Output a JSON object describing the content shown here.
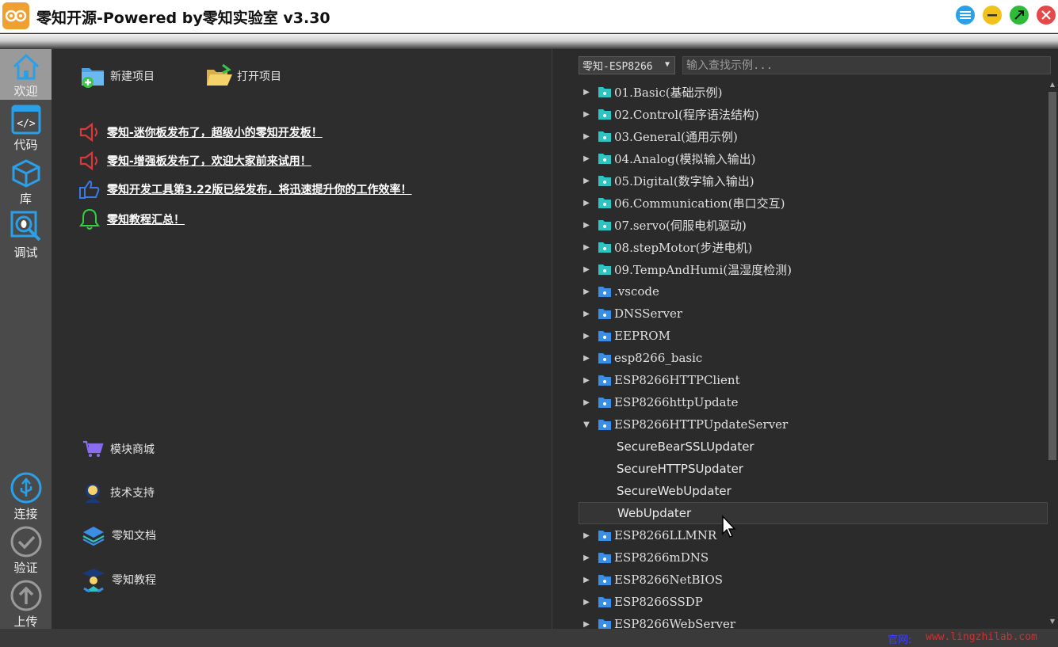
{
  "window": {
    "title": "零知开源-Powered by零知实验室 v3.30"
  },
  "colors": {
    "accent_blue": "#2aa0e8",
    "nav_bg": "#4a4a4a",
    "panel_bg": "#2d2d2d",
    "folder_teal": "#2ec4c4",
    "folder_blue": "#3a8ee6",
    "news_red": "#d83a3a",
    "news_blue": "#3a7ae6",
    "news_green": "#30d040",
    "site_label": "#4040ff",
    "site_url": "#d03030"
  },
  "nav": {
    "welcome": "欢迎",
    "code": "代码",
    "library": "库",
    "debug": "调试",
    "connect": "连接",
    "verify": "验证",
    "upload": "上传"
  },
  "toolbar": {
    "new_project": "新建项目",
    "open_project": "打开项目"
  },
  "news": [
    {
      "text": "零知-迷你板发布了，超级小的零知开发板！",
      "icon": "speaker-icon"
    },
    {
      "text": "零知-增强板发布了，欢迎大家前来试用！",
      "icon": "speaker-icon"
    },
    {
      "text": "零知开发工具第3.22版已经发布，将迅速提升你的工作效率！",
      "icon": "thumbs-up-icon"
    },
    {
      "text": "零知教程汇总！",
      "icon": "bell-icon"
    }
  ],
  "links": {
    "shop": "模块商城",
    "support": "技术支持",
    "docs": "零知文档",
    "tutorial": "零知教程"
  },
  "examples": {
    "board": "零知-ESP8266",
    "search_placeholder": "输入查找示例...",
    "tree": [
      {
        "name": "01.Basic(基础示例)",
        "type": "teal",
        "expanded": false
      },
      {
        "name": "02.Control(程序语法结构)",
        "type": "teal",
        "expanded": false
      },
      {
        "name": "03.General(通用示例)",
        "type": "teal",
        "expanded": false
      },
      {
        "name": "04.Analog(模拟输入输出)",
        "type": "teal",
        "expanded": false
      },
      {
        "name": "05.Digital(数字输入输出)",
        "type": "teal",
        "expanded": false
      },
      {
        "name": "06.Communication(串口交互)",
        "type": "teal",
        "expanded": false
      },
      {
        "name": "07.servo(伺服电机驱动)",
        "type": "teal",
        "expanded": false
      },
      {
        "name": "08.stepMotor(步进电机)",
        "type": "teal",
        "expanded": false
      },
      {
        "name": "09.TempAndHumi(温湿度检测)",
        "type": "teal",
        "expanded": false
      },
      {
        "name": ".vscode",
        "type": "blue",
        "expanded": false
      },
      {
        "name": "DNSServer",
        "type": "blue",
        "expanded": false
      },
      {
        "name": "EEPROM",
        "type": "blue",
        "expanded": false
      },
      {
        "name": "esp8266_basic",
        "type": "blue",
        "expanded": false
      },
      {
        "name": "ESP8266HTTPClient",
        "type": "blue",
        "expanded": false
      },
      {
        "name": "ESP8266httpUpdate",
        "type": "blue",
        "expanded": false
      },
      {
        "name": "ESP8266HTTPUpdateServer",
        "type": "blue",
        "expanded": true
      },
      {
        "name": "SecureBearSSLUpdater",
        "type": "child"
      },
      {
        "name": "SecureHTTPSUpdater",
        "type": "child"
      },
      {
        "name": "SecureWebUpdater",
        "type": "child"
      },
      {
        "name": "WebUpdater",
        "type": "child",
        "selected": true
      },
      {
        "name": "ESP8266LLMNR",
        "type": "blue",
        "expanded": false
      },
      {
        "name": "ESP8266mDNS",
        "type": "blue",
        "expanded": false
      },
      {
        "name": "ESP8266NetBIOS",
        "type": "blue",
        "expanded": false
      },
      {
        "name": "ESP8266SSDP",
        "type": "blue",
        "expanded": false
      },
      {
        "name": "ESP8266WebServer",
        "type": "blue",
        "expanded": false
      }
    ]
  },
  "status": {
    "site_label": "官网:",
    "site_url": "www.lingzhilab.com"
  }
}
